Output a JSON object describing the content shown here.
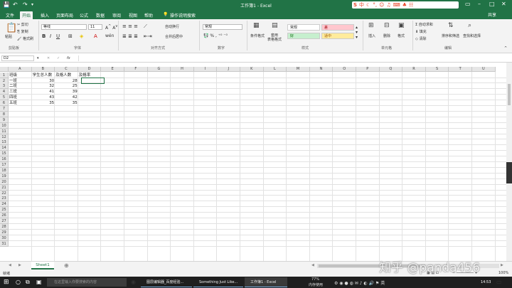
{
  "titlebar": {
    "title": "工作簿1 - Excel",
    "share": "共享"
  },
  "tabs": [
    "文件",
    "开始",
    "插入",
    "页面布局",
    "公式",
    "数据",
    "审阅",
    "视图",
    "帮助"
  ],
  "tell_me": "操作说明搜索",
  "ribbon": {
    "clipboard": {
      "paste": "粘贴",
      "cut": "剪切",
      "copy": "复制",
      "format_painter": "格式刷",
      "label": "剪贴板"
    },
    "font": {
      "name": "等线",
      "size": "11",
      "label": "字体"
    },
    "align": {
      "wrap": "自动换行",
      "merge": "合并后居中",
      "label": "对齐方式"
    },
    "number": {
      "format": "常规",
      "label": "数字"
    },
    "styles": {
      "cond": "条件格式",
      "table": "套用\n表格格式",
      "label": "样式",
      "normal": "常规",
      "bad": "差",
      "good": "好",
      "neutral": "适中"
    },
    "cells": {
      "insert": "插入",
      "delete": "删除",
      "format": "格式",
      "label": "单元格"
    },
    "editing": {
      "autosum": "自动求和",
      "fill": "填充",
      "clear": "清除",
      "sort": "排序和筛选",
      "find": "查找和选择",
      "label": "编辑"
    }
  },
  "formula_bar": {
    "namebox": "D2",
    "fx": "fx"
  },
  "columns": [
    "A",
    "B",
    "C",
    "D",
    "E",
    "F",
    "G",
    "H",
    "I",
    "J",
    "K",
    "L",
    "M",
    "N",
    "O",
    "P",
    "Q",
    "R",
    "S",
    "T",
    "U"
  ],
  "rows": [
    "1",
    "2",
    "3",
    "4",
    "5",
    "6",
    "7",
    "8",
    "9",
    "10",
    "11",
    "12",
    "13",
    "14",
    "15",
    "16",
    "17",
    "18",
    "19",
    "20",
    "21",
    "22",
    "23",
    "24",
    "25",
    "26",
    "27",
    "28",
    "29",
    "30",
    "31"
  ],
  "sheet": {
    "headers": [
      "班级",
      "学生总人数",
      "及格人数",
      "及格率"
    ],
    "data": [
      [
        "一班",
        "30",
        "28"
      ],
      [
        "二班",
        "32",
        "25"
      ],
      [
        "三班",
        "41",
        "39"
      ],
      [
        "四班",
        "43",
        "42"
      ],
      [
        "五班",
        "35",
        "35"
      ]
    ]
  },
  "sheet_tab": "Sheet1",
  "status": {
    "ready": "就绪",
    "zoom": "100%"
  },
  "taskbar": {
    "search": "在这里输入你要搜索的内容",
    "items": [
      "图层编辑器_百度经验...",
      "Something Just Like...",
      "工作簿1 - Excel"
    ],
    "mem": "77%",
    "mem_label": "内存使用",
    "time": "14:53"
  },
  "watermark": "知乎 @panda456"
}
